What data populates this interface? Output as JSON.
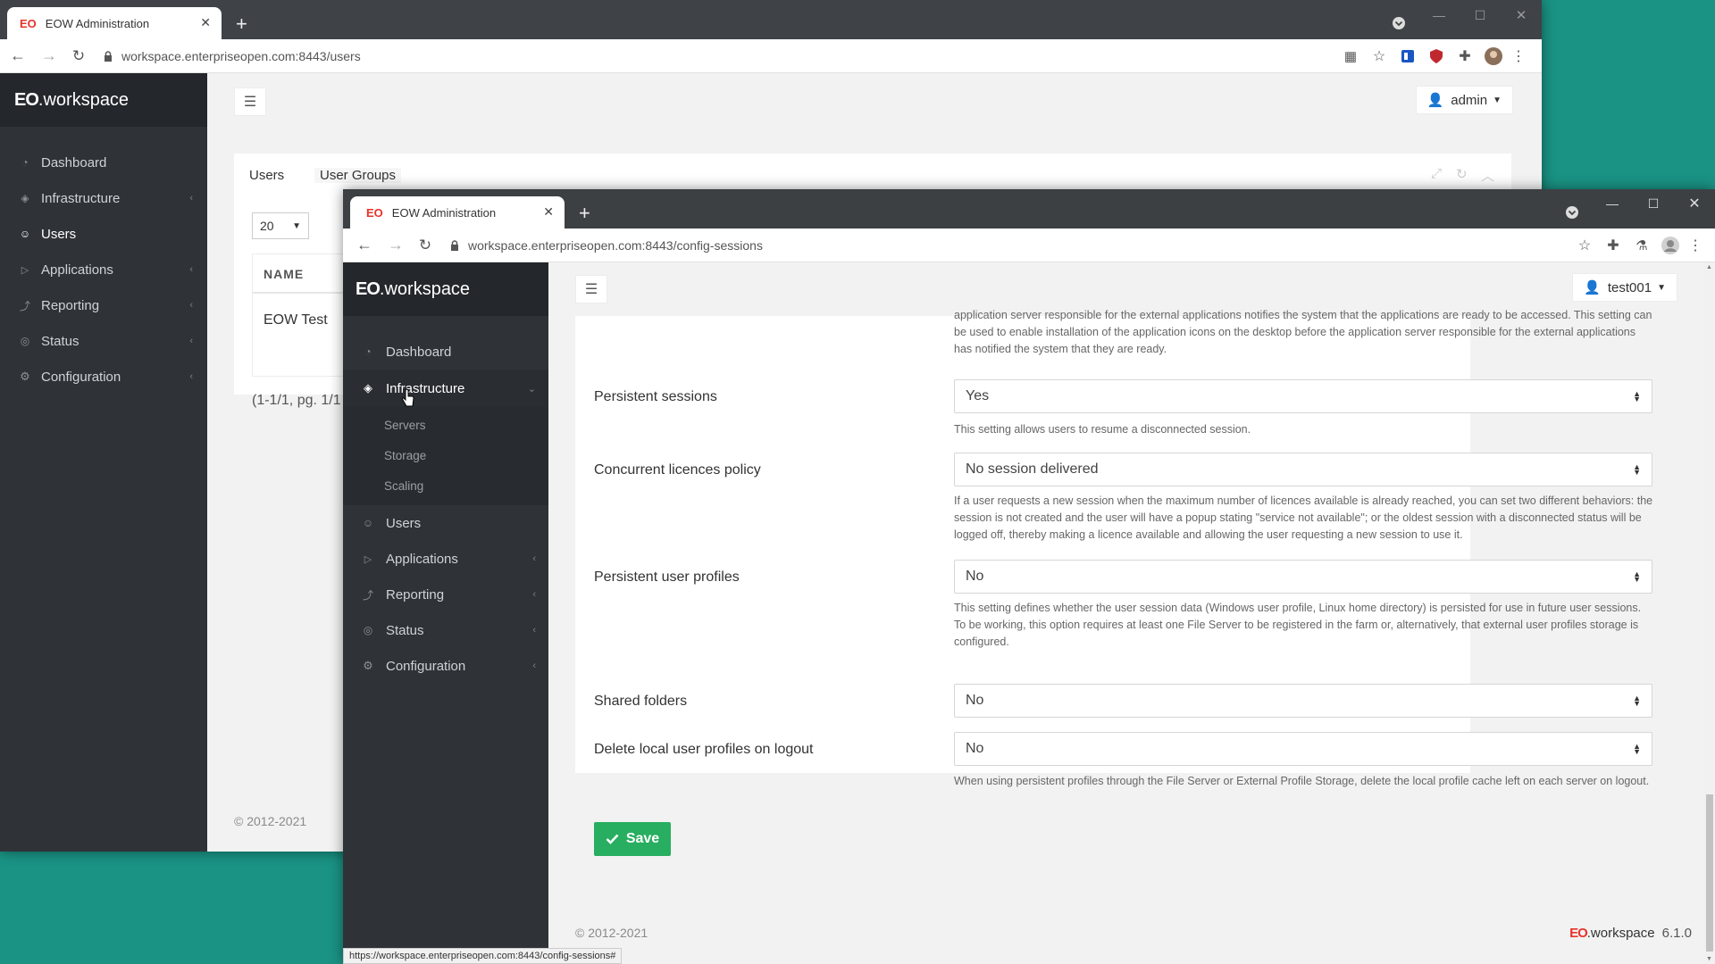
{
  "back": {
    "tab_title": "EOW Administration",
    "url": "workspace.enterpriseopen.com:8443/users",
    "brand_eo": "EO",
    "brand_ws": ".workspace",
    "user": "admin",
    "menu": [
      "Dashboard",
      "Infrastructure",
      "Users",
      "Applications",
      "Reporting",
      "Status",
      "Configuration"
    ],
    "tabs": [
      "Users",
      "User Groups"
    ],
    "page_size": "20",
    "col_name": "NAME",
    "row_name": "EOW Test",
    "pager": "(1-1/1, pg. 1/1",
    "copyright": "© 2012-2021"
  },
  "front": {
    "tab_title": "EOW Administration",
    "url": "workspace.enterpriseopen.com:8443/config-sessions",
    "brand_eo": "EO",
    "brand_ws": ".workspace",
    "user": "test001",
    "menu": {
      "dashboard": "Dashboard",
      "infrastructure": "Infrastructure",
      "servers": "Servers",
      "storage": "Storage",
      "scaling": "Scaling",
      "users": "Users",
      "applications": "Applications",
      "reporting": "Reporting",
      "status": "Status",
      "configuration": "Configuration"
    },
    "top_help": "application server responsible for the external applications notifies the system that the applications are ready to be accessed. This setting can be used to enable installation of the application icons on the desktop before the application server responsible for the external applications has notified the system that they are ready.",
    "settings": {
      "persistent_sessions": {
        "label": "Persistent sessions",
        "value": "Yes",
        "help": "This setting allows users to resume a disconnected session."
      },
      "concurrent_licences": {
        "label": "Concurrent licences policy",
        "value": "No session delivered",
        "help": "If a user requests a new session when the maximum number of licences available is already reached, you can set two different behaviors: the session is not created and the user will have a popup stating \"service not available\"; or the oldest session with a disconnected status will be logged off, thereby making a licence available and allowing the user requesting a new session to use it."
      },
      "persistent_profiles": {
        "label": "Persistent user profiles",
        "value": "No",
        "help1": "This setting defines whether the user session data (Windows user profile, Linux home directory) is persisted for use in future user sessions.",
        "help2": "To be working, this option requires at least one File Server to be registered in the farm or, alternatively, that external user profiles storage is configured."
      },
      "shared_folders": {
        "label": "Shared folders",
        "value": "No"
      },
      "delete_profiles": {
        "label": "Delete local user profiles on logout",
        "value": "No",
        "help": "When using persistent profiles through the File Server or External Profile Storage, delete the local profile cache left on each server on logout."
      }
    },
    "save_label": "Save",
    "copyright": "© 2012-2021",
    "footer_brand_eo": "EO",
    "footer_brand_ws": ".workspace",
    "version": "6.1.0",
    "status_url": "https://workspace.enterpriseopen.com:8443/config-sessions#"
  },
  "colors": {
    "sidebar": "#2f3338",
    "brand_bar": "#24282c",
    "save": "#27ae60",
    "logo_red": "#e8332a",
    "background": "#1a9384"
  }
}
